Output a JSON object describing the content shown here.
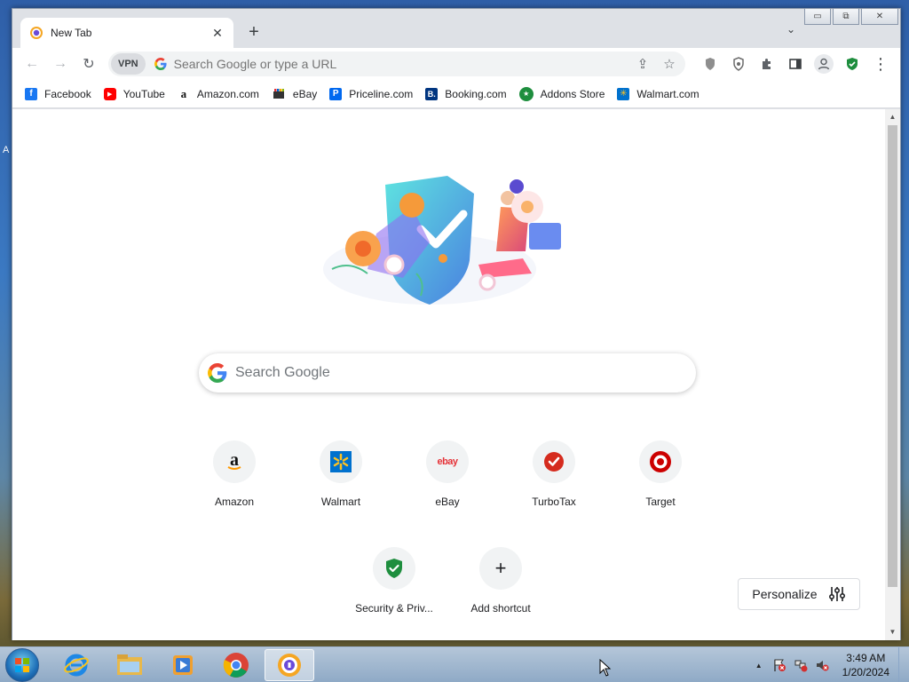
{
  "desktop": {
    "edge_label": "A"
  },
  "browser": {
    "tab": {
      "title": "New Tab",
      "close_glyph": "✕"
    },
    "new_tab_glyph": "+",
    "tab_search_glyph": "⌄",
    "window_controls": {
      "minimize": "▭",
      "maximize": "⧉",
      "close": "✕"
    },
    "toolbar": {
      "back_glyph": "←",
      "forward_glyph": "→",
      "reload_glyph": "↻",
      "vpn_label": "VPN",
      "omnibox_placeholder": "Search Google or type a URL",
      "menu_glyph": "⋮"
    },
    "bookmarks": [
      {
        "label": "Facebook",
        "icon": "facebook-icon",
        "glyph": "f",
        "color": "#1877f2"
      },
      {
        "label": "YouTube",
        "icon": "youtube-icon",
        "glyph": "▶",
        "color": "#ff0000"
      },
      {
        "label": "Amazon.com",
        "icon": "amazon-icon",
        "glyph": "a",
        "color": "#ffffff"
      },
      {
        "label": "eBay",
        "icon": "ebay-icon",
        "glyph": "",
        "color": "#ffffff"
      },
      {
        "label": "Priceline.com",
        "icon": "priceline-icon",
        "glyph": "P",
        "color": "#0068ef"
      },
      {
        "label": "Booking.com",
        "icon": "booking-icon",
        "glyph": "B.",
        "color": "#003580"
      },
      {
        "label": "Addons Store",
        "icon": "addons-store-icon",
        "glyph": "★",
        "color": "#1e8e3e"
      },
      {
        "label": "Walmart.com",
        "icon": "walmart-icon",
        "glyph": "✳",
        "color": "#0071ce"
      }
    ]
  },
  "newtab": {
    "search_placeholder": "Search Google",
    "shortcuts": [
      {
        "label": "Amazon",
        "icon": "amazon-icon"
      },
      {
        "label": "Walmart",
        "icon": "walmart-icon"
      },
      {
        "label": "eBay",
        "icon": "ebay-icon",
        "text": "ebay"
      },
      {
        "label": "TurboTax",
        "icon": "turbotax-icon"
      },
      {
        "label": "Target",
        "icon": "target-icon"
      },
      {
        "label": "Security & Priv...",
        "icon": "shield-check-icon"
      },
      {
        "label": "Add shortcut",
        "icon": "plus-icon",
        "glyph": "+"
      }
    ],
    "personalize_label": "Personalize"
  },
  "taskbar": {
    "apps": [
      "internet-explorer-icon",
      "file-explorer-icon",
      "media-player-icon",
      "chrome-icon",
      "browser-icon"
    ],
    "tray_arrow": "▲",
    "clock_time": "3:49 AM",
    "clock_date": "1/20/2024"
  },
  "colors": {
    "accent_blue": "#1a73e8",
    "shield_green": "#1e8e3e",
    "target_red": "#cc0000"
  }
}
